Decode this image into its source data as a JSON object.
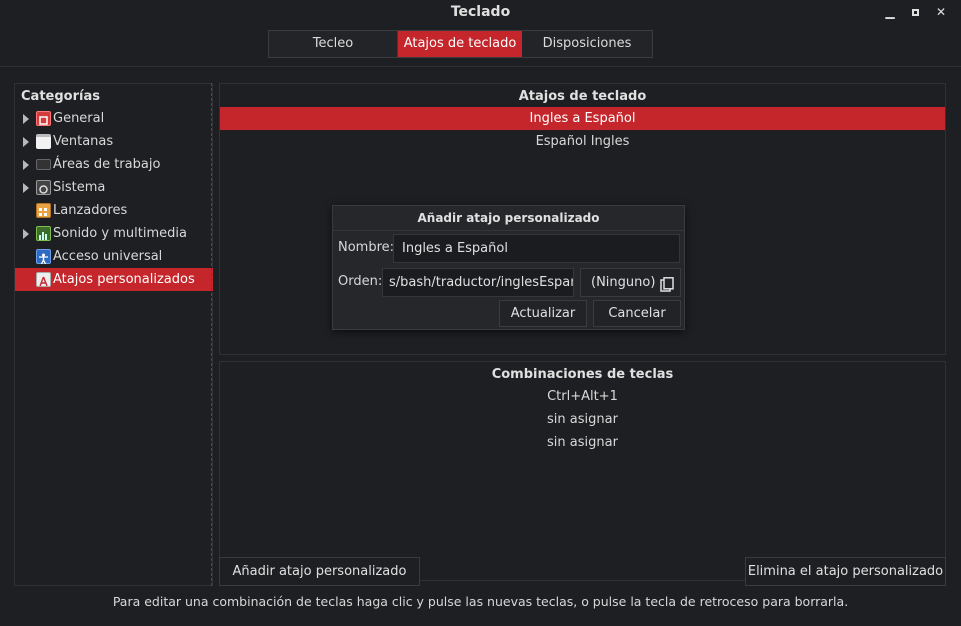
{
  "window": {
    "title": "Teclado",
    "minimize_icon": "minimize-icon",
    "maximize_icon": "maximize-icon",
    "close_icon": "close-icon"
  },
  "tabs": [
    {
      "label": "Tecleo",
      "selected": false
    },
    {
      "label": "Atajos de teclado",
      "selected": true
    },
    {
      "label": "Disposiciones",
      "selected": false
    }
  ],
  "sidebar": {
    "header": "Categorías",
    "items": [
      {
        "label": "General",
        "icon": "general-icon",
        "expandable": true
      },
      {
        "label": "Ventanas",
        "icon": "window-icon",
        "expandable": true
      },
      {
        "label": "Áreas de trabajo",
        "icon": "workspace-icon",
        "expandable": true
      },
      {
        "label": "Sistema",
        "icon": "system-icon",
        "expandable": true
      },
      {
        "label": "Lanzadores",
        "icon": "launcher-icon",
        "expandable": false
      },
      {
        "label": "Sonido y multimedia",
        "icon": "multimedia-icon",
        "expandable": true
      },
      {
        "label": "Acceso universal",
        "icon": "accessibility-icon",
        "expandable": false
      },
      {
        "label": "Atajos personalizados",
        "icon": "custom-shortcut-icon",
        "expandable": false,
        "selected": true
      }
    ]
  },
  "shortcuts_panel": {
    "title": "Atajos de teclado",
    "items": [
      "Ingles a Español",
      "Español Ingles"
    ],
    "selected_index": 0
  },
  "keybindings_panel": {
    "title": "Combinaciones de teclas",
    "items": [
      "Ctrl+Alt+1",
      "sin asignar",
      "sin asignar"
    ]
  },
  "dialog": {
    "title": "Añadir atajo personalizado",
    "name_label": "Nombre:",
    "name_value": "Ingles a Español",
    "command_label": "Orden:",
    "command_value": "s/bash/traductor/inglesEspaniol",
    "file_chooser_label": "(Ninguno)",
    "file_chooser_icon": "file-copy-icon",
    "update_button": "Actualizar",
    "cancel_button": "Cancelar"
  },
  "actions": {
    "add_button": "Añadir atajo personalizado",
    "remove_button": "Elimina el atajo personalizado"
  },
  "footer": "Para editar una combinación de teclas haga clic y pulse las nuevas teclas, o pulse la tecla de retroceso para borrarla.",
  "colors": {
    "accent": "#c5262c",
    "background": "#1e1f22"
  }
}
